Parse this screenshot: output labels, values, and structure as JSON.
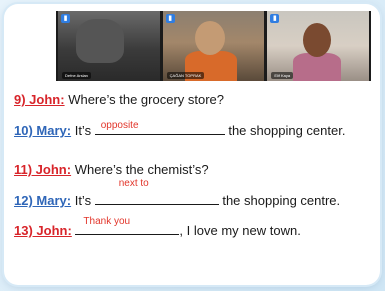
{
  "video": {
    "participants": [
      {
        "name": "Defne Arslan",
        "mic": "mic-icon"
      },
      {
        "name": "ÇAĞAN TOPRAK",
        "mic": "mic-icon"
      },
      {
        "name": "Elif Kaya",
        "mic": "mic-icon"
      }
    ]
  },
  "dialogue": [
    {
      "speaker": "9) John:",
      "text": "Where’s the grocery store?"
    },
    {
      "speaker": "10) Mary:",
      "pre": "It’s",
      "answer": "opposite",
      "post": "the shopping center."
    },
    {
      "speaker": "11) John:",
      "text": "Where’s the chemist’s?"
    },
    {
      "speaker": "12) Mary:",
      "pre": "It’s",
      "answer": "next to",
      "post": "the shopping centre."
    },
    {
      "speaker": "13) John:",
      "pre": "",
      "answer": "Thank you",
      "post": ", I love my new town."
    }
  ],
  "colors": {
    "john": "#d8242a",
    "mary": "#2f66b8",
    "answer": "#e2352a"
  }
}
